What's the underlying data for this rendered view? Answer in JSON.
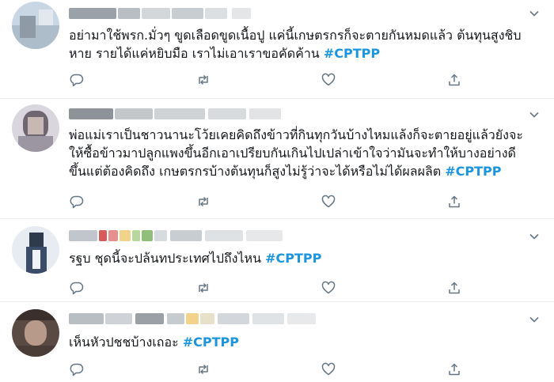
{
  "tweets": [
    {
      "lines": [
        "อย่ามาใช้พรก.มั่วๆ  ขูดเลือดขูดเนื้อปู แค่นี้เกษตรกรก็จะตายกันหมดแล้ว ต้นทุนสูงชิบ",
        "หาย รายได้แค่หยิบมือ เราไม่เอาเราขอคัดค้าน"
      ],
      "hashtag": "#CPTPP"
    },
    {
      "lines": [
        "พ่อแม่เราเป็นชาวนานะโว้ยเคยคิดถึงข้าวที่กินทุกวันบ้างไหมแล้งก็จะตายอยู่แล้วยังจะ",
        "ให้ซื้อข้าวมาปลูกแพงขึ้นอีกเอาเปรียบกันเกินไปเปล่าเข้าใจว่ามันจะทำให้บางอย่างดี",
        "ขึ้นแต่ต้องคิดถึง เกษตรกรบ้างต้นทุนก็สูงไม่รู้ว่าจะได้หรือไม่ได้ผลผลิต"
      ],
      "hashtag": "#CPTPP"
    },
    {
      "lines": [
        "รฐบ ชุดนี้จะปล้นทประเทศไปถึงไหน"
      ],
      "hashtag": "#CPTPP"
    },
    {
      "lines": [
        "เห็นหัวปชชบ้างเถอะ"
      ],
      "hashtag": "#CPTPP"
    }
  ],
  "colors": {
    "hashtag": "#1b95e0",
    "icon": "#657786",
    "divider": "#e6ecf0"
  },
  "icons": [
    "reply-icon",
    "retweet-icon",
    "like-icon",
    "share-icon",
    "chevron-down-icon"
  ]
}
